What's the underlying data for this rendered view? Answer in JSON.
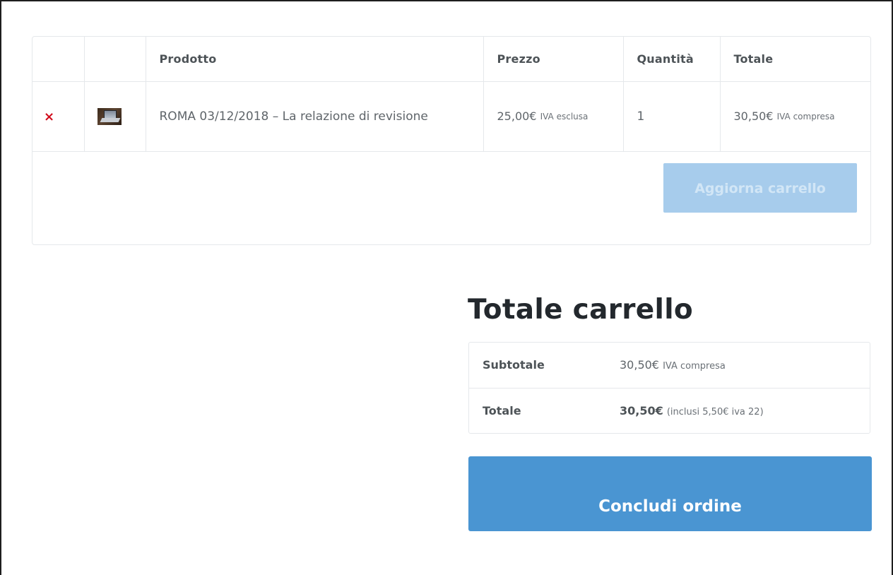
{
  "cart": {
    "headers": {
      "remove": "",
      "thumbnail": "",
      "product": "Prodotto",
      "price": "Prezzo",
      "quantity": "Quantità",
      "total": "Totale"
    },
    "items": [
      {
        "remove_icon": "×",
        "thumbnail_icon": "laptop-thumbnail",
        "name": "ROMA 03/12/2018 – La relazione di revisione",
        "price": "25,00€",
        "price_tax_note": "IVA esclusa",
        "quantity": "1",
        "total": "30,50€",
        "total_tax_note": "IVA compresa"
      }
    ],
    "update_button": "Aggiorna carrello"
  },
  "totals": {
    "title": "Totale carrello",
    "subtotal_label": "Subtotale",
    "subtotal_value": "30,50€",
    "subtotal_note": "IVA compresa",
    "total_label": "Totale",
    "total_value": "30,50€",
    "total_note": "(inclusi 5,50€ iva 22)"
  },
  "checkout_button": "Concludi ordine",
  "colors": {
    "remove": "#d10b1b",
    "update_button_bg": "#a7ccec",
    "checkout_button_bg": "#4a95d2",
    "title_text": "#23282d"
  }
}
